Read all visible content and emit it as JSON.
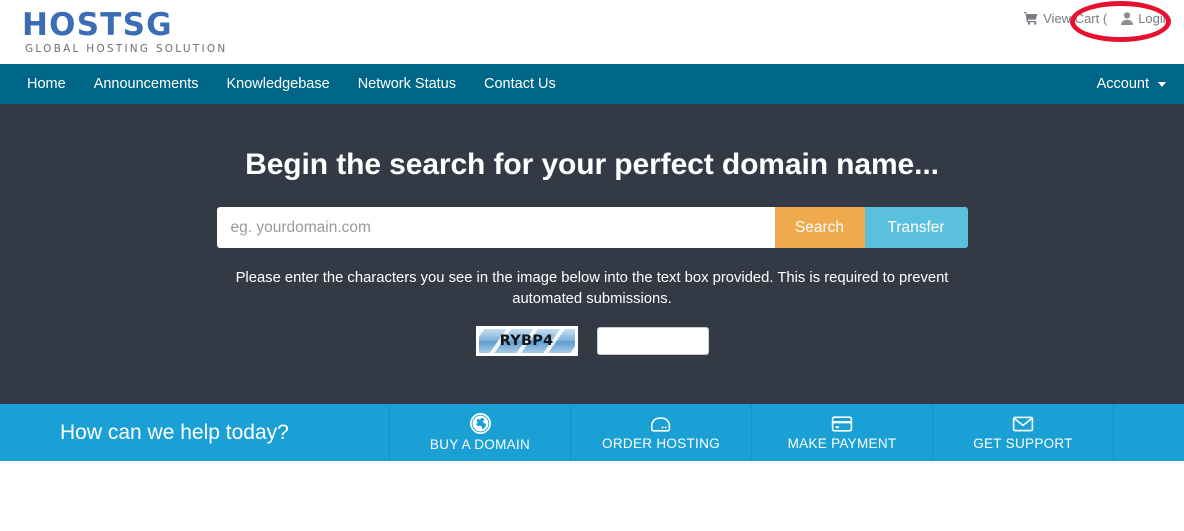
{
  "header": {
    "logo": {
      "name": "HOSTSG",
      "tagline": "GLOBAL HOSTING SOLUTION",
      "color": "#3b6cb4"
    },
    "links": [
      {
        "label": "View Cart (",
        "icon": "shopping-cart-icon"
      },
      {
        "label": "Login",
        "icon": "user-icon"
      }
    ]
  },
  "annotation": {
    "type": "ellipse-highlight",
    "color": "#e8112d",
    "target": "Login"
  },
  "navbar": {
    "background": "#006687",
    "items": [
      {
        "label": "Home"
      },
      {
        "label": "Announcements"
      },
      {
        "label": "Knowledgebase"
      },
      {
        "label": "Network Status"
      },
      {
        "label": "Contact Us"
      }
    ],
    "account": {
      "label": "Account",
      "icon": "chevron-down-icon"
    }
  },
  "hero": {
    "background": "#343a45",
    "title": "Begin the search for your perfect domain name...",
    "search": {
      "placeholder": "eg. yourdomain.com",
      "value": "",
      "search_label": "Search",
      "search_color": "#eeaa4d",
      "transfer_label": "Transfer",
      "transfer_color": "#5bc0de"
    },
    "captcha": {
      "instructions": "Please enter the characters you see in the image below into the text box provided. This is required to prevent automated submissions.",
      "code": "RYBP4",
      "input_value": "",
      "input_placeholder": ""
    }
  },
  "helpbar": {
    "background": "#1ba0d6",
    "title": "How can we help today?",
    "tiles": [
      {
        "label": "BUY A DOMAIN",
        "icon": "globe-icon"
      },
      {
        "label": "ORDER HOSTING",
        "icon": "server-icon"
      },
      {
        "label": "MAKE PAYMENT",
        "icon": "credit-card-icon"
      },
      {
        "label": "GET SUPPORT",
        "icon": "envelope-icon"
      }
    ]
  }
}
